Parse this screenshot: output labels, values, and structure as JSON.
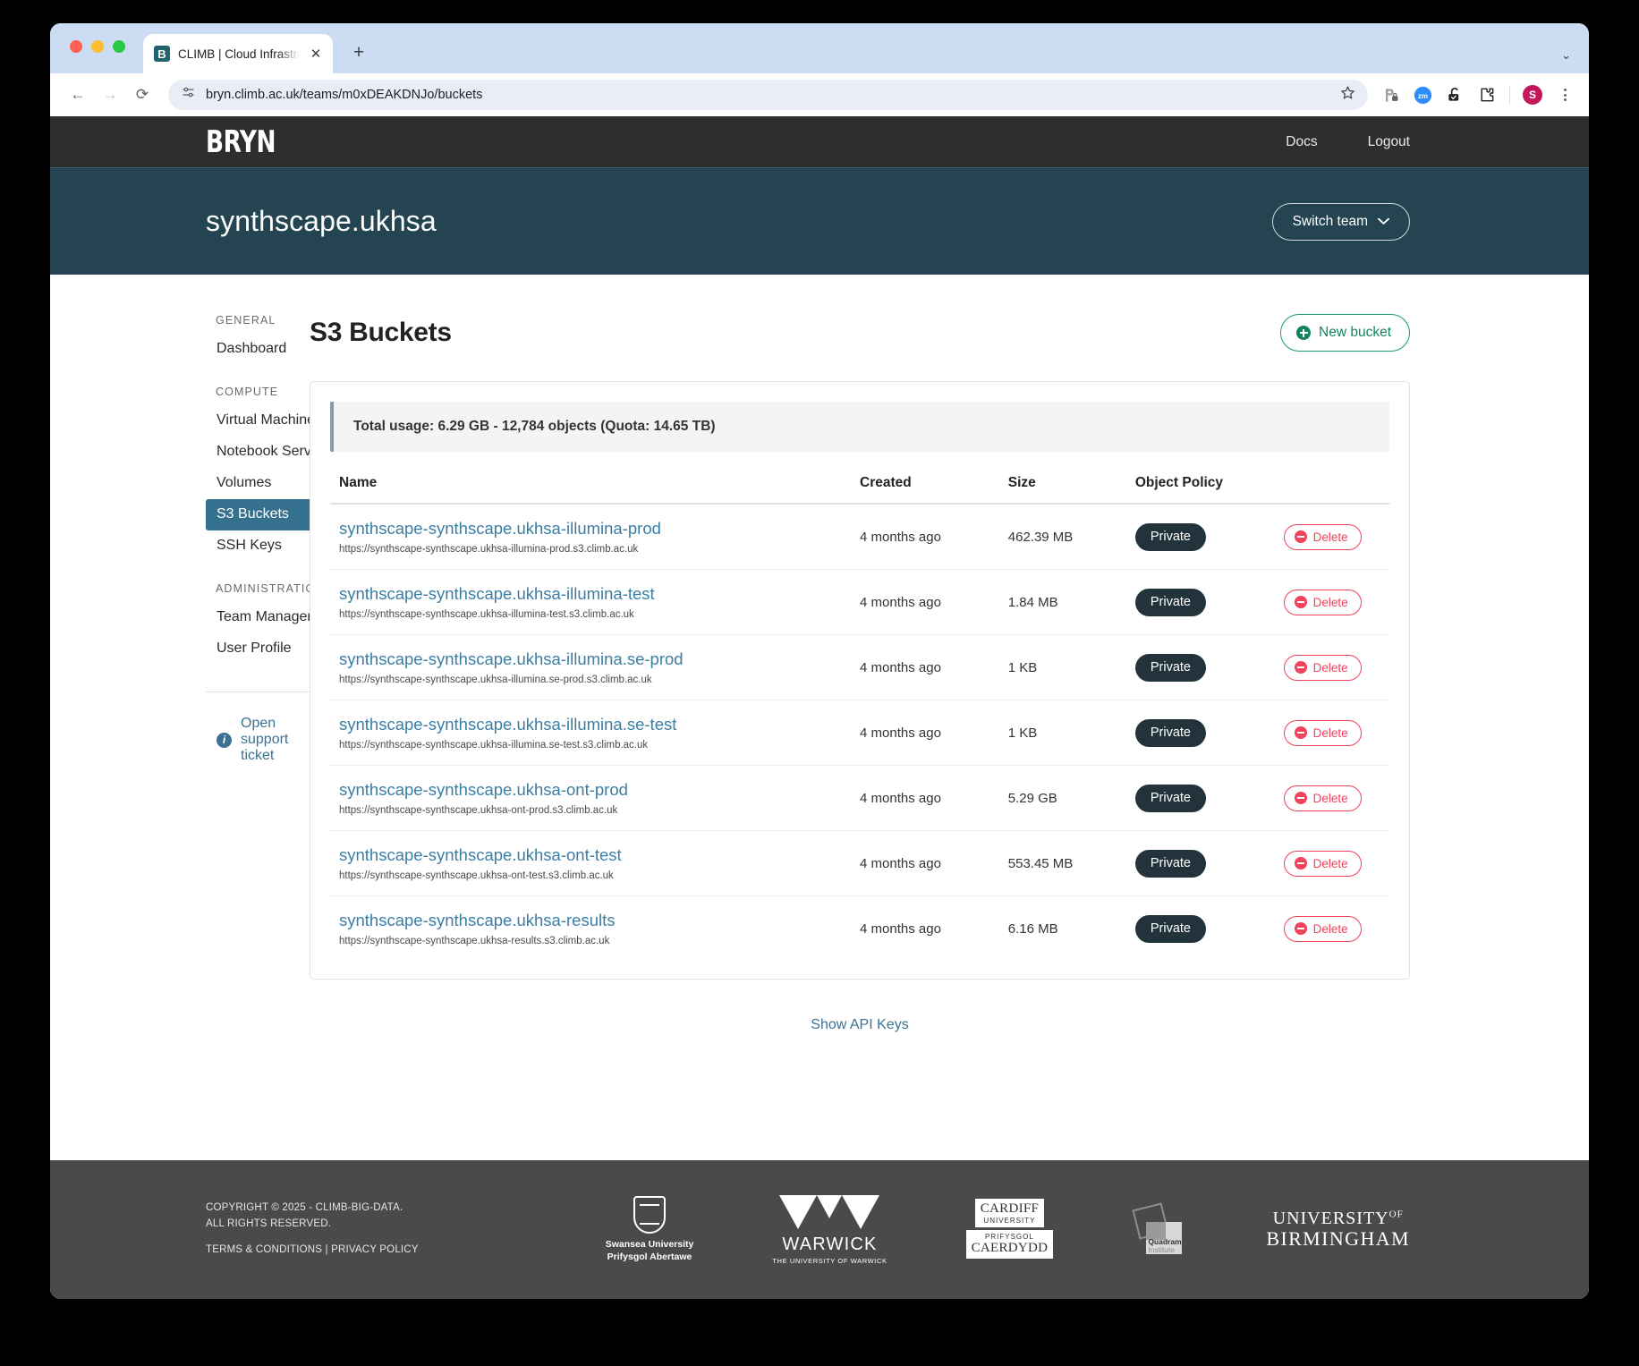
{
  "browser": {
    "tab": {
      "title": "CLIMB | Cloud Infrastructure f",
      "favicon_letter": "B",
      "favicon_name": "climb-favicon"
    },
    "newtab_label": "+",
    "close_label": "✕",
    "tabstrip_chevron": "⌄",
    "nav": {
      "back": "←",
      "forward": "→",
      "reload": "⟳"
    },
    "omnibox": {
      "url": "bryn.climb.ac.uk/teams/m0xDEAKDNJo/buckets",
      "site_info_icon": "tune-icon",
      "bookmark_icon": "star-icon"
    },
    "toolbar_icons": [
      "password-manager-icon",
      "zoom-extension-icon",
      "unlock-extension-icon",
      "puzzle-extensions-icon"
    ],
    "profile_initial": "S"
  },
  "app": {
    "logo": "BRYN",
    "nav_links": [
      {
        "label": "Docs"
      },
      {
        "label": "Logout"
      }
    ],
    "team_name": "synthscape.ukhsa",
    "switch_team_label": "Switch team"
  },
  "sidebar": {
    "groups": [
      {
        "title": "GENERAL",
        "items": [
          {
            "label": "Dashboard",
            "active": false
          }
        ]
      },
      {
        "title": "COMPUTE",
        "items": [
          {
            "label": "Virtual Machines",
            "active": false
          },
          {
            "label": "Notebook Servers",
            "active": false
          },
          {
            "label": "Volumes",
            "active": false
          },
          {
            "label": "S3 Buckets",
            "active": true
          },
          {
            "label": "SSH Keys",
            "active": false
          }
        ]
      },
      {
        "title": "ADMINISTRATION",
        "items": [
          {
            "label": "Team Management",
            "active": false
          },
          {
            "label": "User Profile",
            "active": false
          }
        ]
      }
    ],
    "support_link": "Open support ticket"
  },
  "main": {
    "page_title": "S3 Buckets",
    "new_bucket_label": "New bucket",
    "usage_text": "Total usage: 6.29 GB - 12,784 objects (Quota: 14.65 TB)",
    "columns": [
      "Name",
      "Created",
      "Size",
      "Object Policy",
      ""
    ],
    "delete_label": "Delete",
    "show_api_keys": "Show API Keys",
    "rows": [
      {
        "name": "synthscape-synthscape.ukhsa-illumina-prod",
        "url": "https://synthscape-synthscape.ukhsa-illumina-prod.s3.climb.ac.uk",
        "created": "4 months ago",
        "size": "462.39 MB",
        "policy": "Private"
      },
      {
        "name": "synthscape-synthscape.ukhsa-illumina-test",
        "url": "https://synthscape-synthscape.ukhsa-illumina-test.s3.climb.ac.uk",
        "created": "4 months ago",
        "size": "1.84 MB",
        "policy": "Private"
      },
      {
        "name": "synthscape-synthscape.ukhsa-illumina.se-prod",
        "url": "https://synthscape-synthscape.ukhsa-illumina.se-prod.s3.climb.ac.uk",
        "created": "4 months ago",
        "size": "1 KB",
        "policy": "Private"
      },
      {
        "name": "synthscape-synthscape.ukhsa-illumina.se-test",
        "url": "https://synthscape-synthscape.ukhsa-illumina.se-test.s3.climb.ac.uk",
        "created": "4 months ago",
        "size": "1 KB",
        "policy": "Private"
      },
      {
        "name": "synthscape-synthscape.ukhsa-ont-prod",
        "url": "https://synthscape-synthscape.ukhsa-ont-prod.s3.climb.ac.uk",
        "created": "4 months ago",
        "size": "5.29 GB",
        "policy": "Private"
      },
      {
        "name": "synthscape-synthscape.ukhsa-ont-test",
        "url": "https://synthscape-synthscape.ukhsa-ont-test.s3.climb.ac.uk",
        "created": "4 months ago",
        "size": "553.45 MB",
        "policy": "Private"
      },
      {
        "name": "synthscape-synthscape.ukhsa-results",
        "url": "https://synthscape-synthscape.ukhsa-results.s3.climb.ac.uk",
        "created": "4 months ago",
        "size": "6.16 MB",
        "policy": "Private"
      }
    ]
  },
  "footer": {
    "copyright_line1": "COPYRIGHT © 2025 - CLIMB-BIG-DATA.",
    "copyright_line2": "ALL RIGHTS RESERVED.",
    "legal_links": "TERMS & CONDITIONS | PRIVACY POLICY",
    "partners": [
      {
        "name": "Swansea University",
        "line1": "Swansea University",
        "line2": "Prifysgol Abertawe"
      },
      {
        "name": "University of Warwick",
        "line1": "WARWICK",
        "line2": "THE UNIVERSITY OF WARWICK"
      },
      {
        "name": "Cardiff University",
        "line1": "CARDIFF",
        "line2": "UNIVERSITY",
        "line3": "PRIFYSGOL",
        "line4": "CAERDYDD"
      },
      {
        "name": "Quadram Institute",
        "line1": "Quadram",
        "line2": "Institute"
      },
      {
        "name": "University of Birmingham",
        "line1": "UNIVERSITY",
        "line1_sup": "OF",
        "line2": "BIRMINGHAM"
      }
    ]
  },
  "colors": {
    "navbar": "#2e2e2e",
    "team_band": "#234450",
    "sidebar_active": "#35708f",
    "link": "#3b7ea4",
    "accent_green": "#12855f",
    "danger_red": "#f2425c",
    "badge_dark": "#22333b",
    "footer": "#4a4a4a"
  }
}
